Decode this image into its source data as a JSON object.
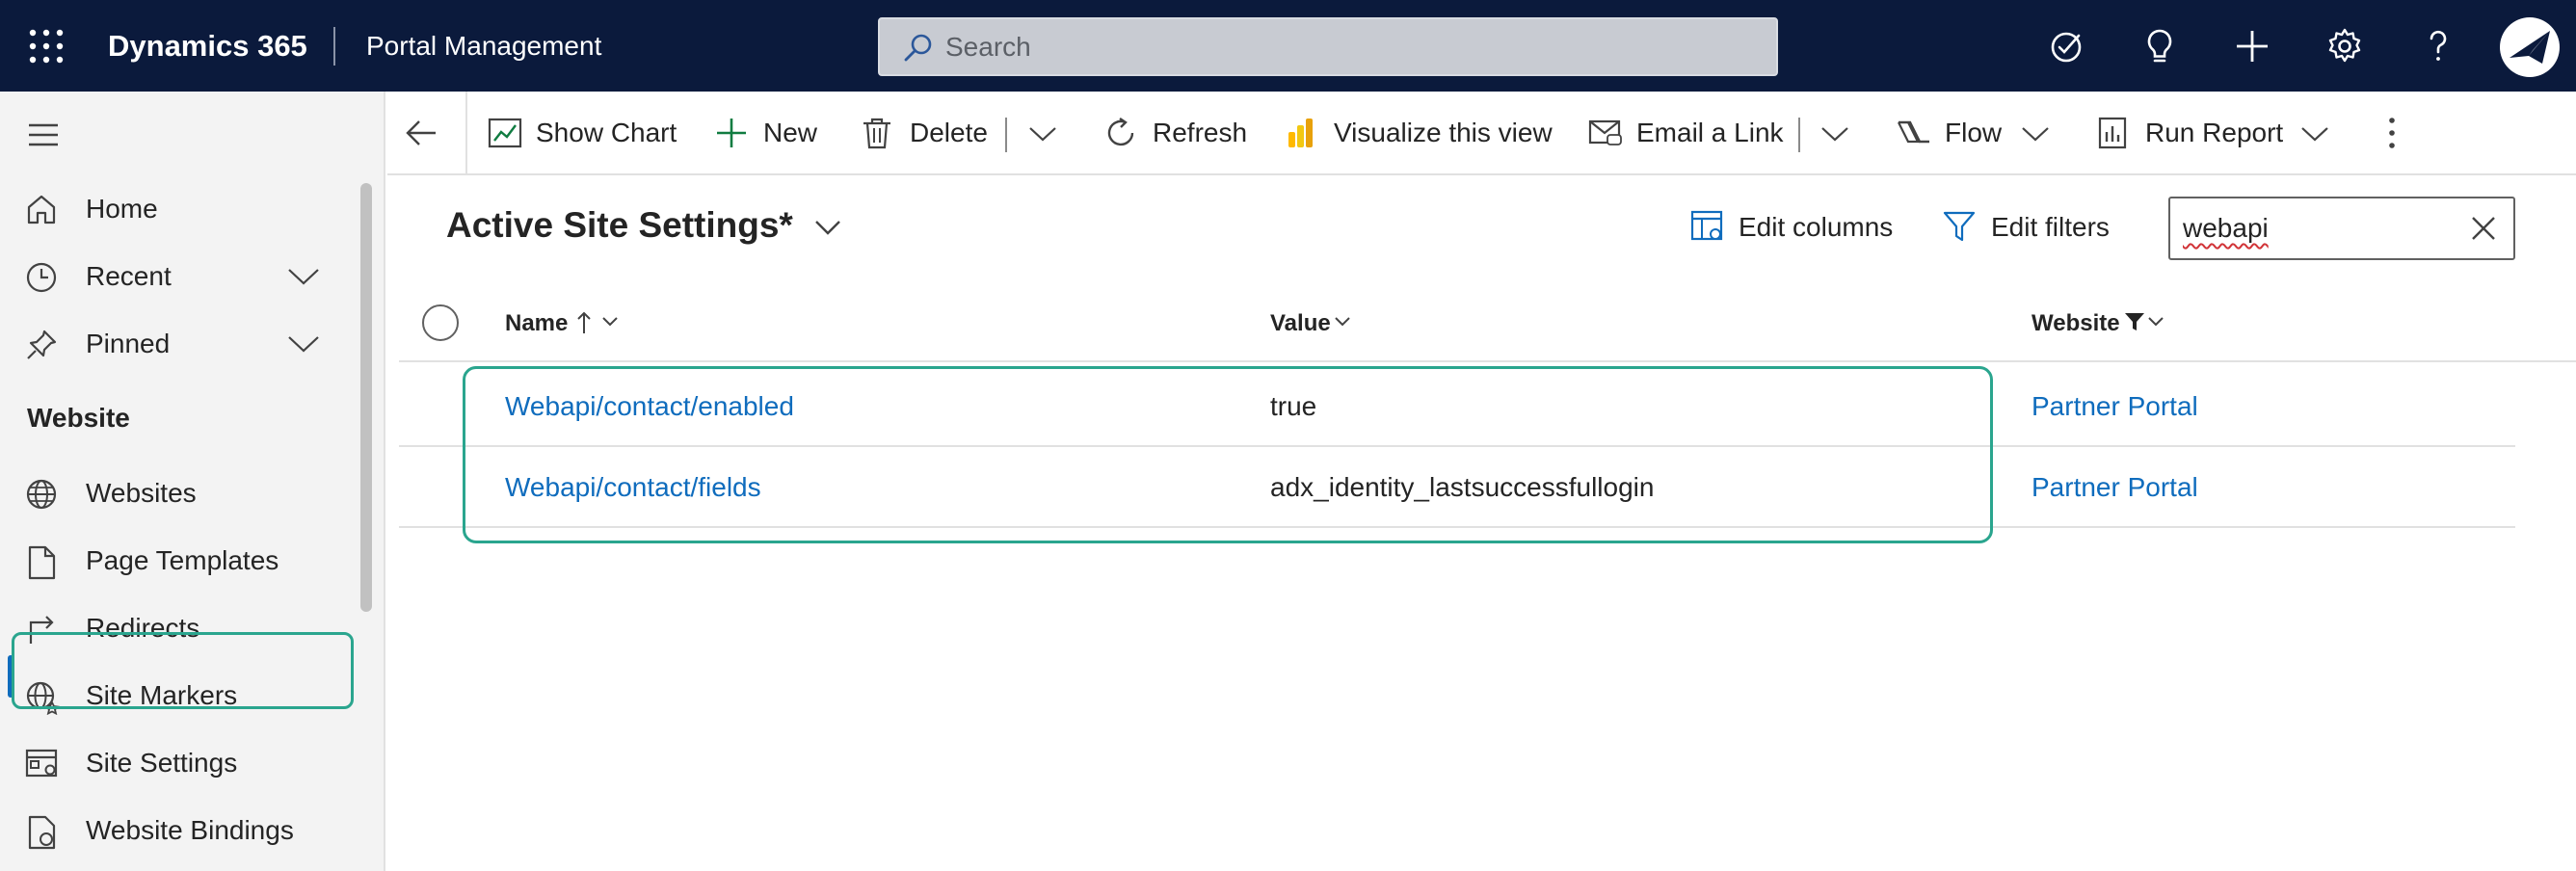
{
  "header": {
    "app_name": "Dynamics 365",
    "area_name": "Portal Management",
    "search_placeholder": "Search",
    "icons": [
      "waffle-icon",
      "task-flow-icon",
      "lightbulb-icon",
      "plus-icon",
      "gear-icon",
      "help-icon",
      "user-avatar"
    ]
  },
  "sidebar": {
    "items": [
      {
        "label": "Home",
        "icon": "home-icon"
      },
      {
        "label": "Recent",
        "icon": "clock-icon",
        "expandable": true
      },
      {
        "label": "Pinned",
        "icon": "pin-icon",
        "expandable": true
      }
    ],
    "group_label": "Website",
    "website_items": [
      {
        "label": "Websites",
        "icon": "globe-icon"
      },
      {
        "label": "Page Templates",
        "icon": "page-icon"
      },
      {
        "label": "Redirects",
        "icon": "redirect-icon"
      },
      {
        "label": "Site Markers",
        "icon": "globe-star-icon"
      },
      {
        "label": "Site Settings",
        "icon": "settings-window-icon",
        "active": true
      },
      {
        "label": "Website Bindings",
        "icon": "binding-icon"
      }
    ]
  },
  "commandbar": {
    "show_chart": "Show Chart",
    "new": "New",
    "delete": "Delete",
    "refresh": "Refresh",
    "visualize": "Visualize this view",
    "email_link": "Email a Link",
    "flow": "Flow",
    "run_report": "Run Report"
  },
  "view": {
    "title": "Active Site Settings*",
    "edit_columns": "Edit columns",
    "edit_filters": "Edit filters",
    "filter_value": "webapi"
  },
  "grid": {
    "columns": [
      "Name",
      "Value",
      "Website"
    ],
    "sort": "Name ascending",
    "website_filtered": true,
    "rows": [
      {
        "name": "Webapi/contact/enabled",
        "value": "true",
        "website": "Partner Portal"
      },
      {
        "name": "Webapi/contact/fields",
        "value": "adx_identity_lastsuccessfullogin",
        "website": "Partner Portal"
      }
    ]
  },
  "colors": {
    "topbar": "#0b1a3c",
    "link": "#0f6cbd",
    "highlight": "#2aa58e",
    "accent": "#0f6cbd"
  }
}
